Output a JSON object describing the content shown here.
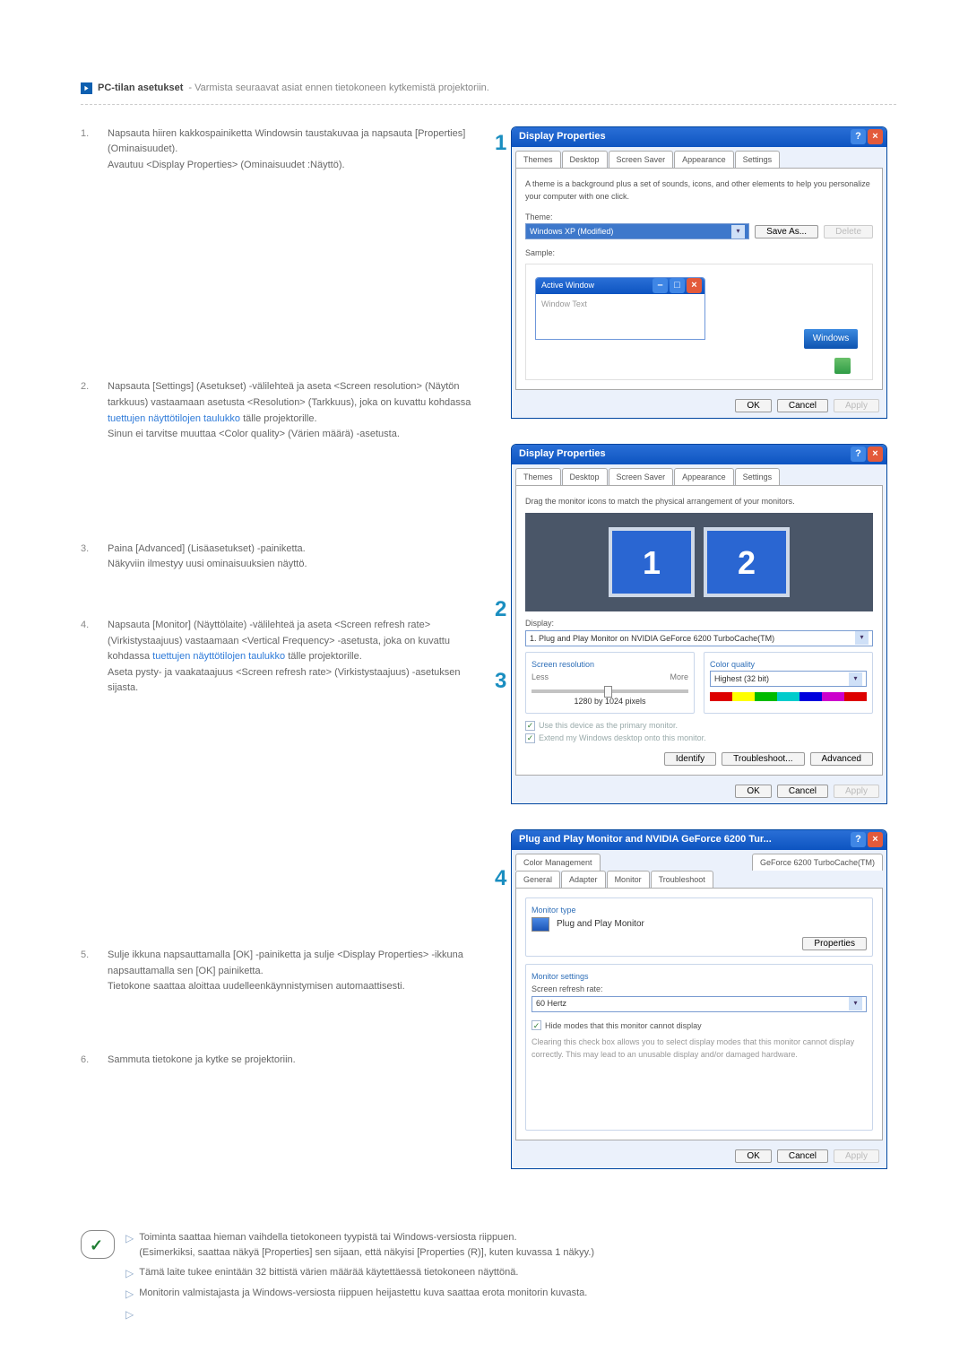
{
  "heading": {
    "title": "PC-tilan asetukset",
    "subtitle": " - Varmista seuraavat asiat ennen tietokoneen kytkemistä projektoriin."
  },
  "steps": {
    "1": {
      "num": "1.",
      "a": "Napsauta hiiren kakkospainiketta Windowsin taustakuvaa ja napsauta [Properties] (Ominaisuudet).",
      "b": "Avautuu <Display Properties> (Ominaisuudet :Näyttö)."
    },
    "2": {
      "num": "2.",
      "a": "Napsauta [Settings] (Asetukset) -välilehteä ja aseta <Screen resolution> (Näytön tarkkuus) vastaamaan asetusta <Resolution> (Tarkkuus), joka on kuvattu kohdassa ",
      "link": "tuettujen näyttötilojen taulukko",
      "a2": " tälle projektorille.",
      "b": "Sinun ei tarvitse muuttaa <Color quality> (Värien määrä) -asetusta."
    },
    "3": {
      "num": "3.",
      "a": "Paina [Advanced] (Lisäasetukset) -painiketta.",
      "b": "Näkyviin ilmestyy uusi ominaisuuksien näyttö."
    },
    "4": {
      "num": "4.",
      "a": "Napsauta [Monitor] (Näyttölaite) -välilehteä ja aseta <Screen refresh rate> (Virkistystaajuus) vastaamaan <Vertical Frequency> -asetusta, joka on kuvattu kohdassa ",
      "link": "tuettujen näyttötilojen taulukko",
      "a2": " tälle projektorille.",
      "b": "Aseta pysty- ja vaakataajuus <Screen refresh rate> (Virkistystaajuus) -asetuksen sijasta."
    },
    "5": {
      "num": "5.",
      "a": "Sulje ikkuna napsauttamalla [OK] -painiketta ja sulje <Display Properties> -ikkuna napsauttamalla sen [OK] painiketta.",
      "b": "Tietokone saattaa aloittaa uudelleenkäynnistymisen automaattisesti."
    },
    "6": {
      "num": "6.",
      "a": "Sammuta tietokone ja kytke se projektoriin."
    }
  },
  "notes": {
    "1": "Toiminta saattaa hieman vaihdella tietokoneen tyypistä tai Windows-versiosta riippuen.",
    "1b": "(Esimerkiksi, saattaa näkyä [Properties] sen sijaan, että näkyisi [Properties (R)], kuten kuvassa 1 näkyy.)",
    "2": "Tämä laite tukee enintään 32 bittistä värien määrää käytettäessä tietokoneen näyttönä.",
    "3": "Monitorin valmistajasta ja Windows-versiosta riippuen heijastettu kuva saattaa erota monitorin kuvasta."
  },
  "callouts": {
    "1": "1",
    "2": "2",
    "3": "3",
    "4": "4"
  },
  "win1": {
    "title": "Display Properties",
    "tabs": [
      "Themes",
      "Desktop",
      "Screen Saver",
      "Appearance",
      "Settings"
    ],
    "desc": "A theme is a background plus a set of sounds, icons, and other elements to help you personalize your computer with one click.",
    "themeLabel": "Theme:",
    "themeValue": "Windows XP (Modified)",
    "saveas": "Save As...",
    "delete": "Delete",
    "sample": "Sample:",
    "aw": "Active Window",
    "wt": "Window Text",
    "logo": "Windows",
    "ok": "OK",
    "cancel": "Cancel",
    "apply": "Apply"
  },
  "win2": {
    "title": "Display Properties",
    "tabs": [
      "Themes",
      "Desktop",
      "Screen Saver",
      "Appearance",
      "Settings"
    ],
    "instr": "Drag the monitor icons to match the physical arrangement of your monitors.",
    "m1": "1",
    "m2": "2",
    "displayLabel": "Display:",
    "displayValue": "1. Plug and Play Monitor on NVIDIA GeForce 6200 TurboCache(TM)",
    "sr": "Screen resolution",
    "less": "Less",
    "more": "More",
    "res": "1280 by 1024 pixels",
    "cq": "Color quality",
    "cqv": "Highest (32 bit)",
    "chk1": "Use this device as the primary monitor.",
    "chk2": "Extend my Windows desktop onto this monitor.",
    "identify": "Identify",
    "troubleshoot": "Troubleshoot...",
    "advanced": "Advanced",
    "ok": "OK",
    "cancel": "Cancel",
    "apply": "Apply"
  },
  "win3": {
    "title": "Plug and Play Monitor and NVIDIA GeForce 6200 Tur...",
    "tabs_row1": [
      "Color Management",
      "GeForce 6200 TurboCache(TM)"
    ],
    "tabs_row2": [
      "General",
      "Adapter",
      "Monitor",
      "Troubleshoot"
    ],
    "mt": "Monitor type",
    "mtv": "Plug and Play Monitor",
    "props": "Properties",
    "ms": "Monitor settings",
    "srr": "Screen refresh rate:",
    "hz": "60 Hertz",
    "hide": "Hide modes that this monitor cannot display",
    "warn": "Clearing this check box allows you to select display modes that this monitor cannot display correctly. This may lead to an unusable display and/or damaged hardware.",
    "ok": "OK",
    "cancel": "Cancel",
    "apply": "Apply"
  }
}
